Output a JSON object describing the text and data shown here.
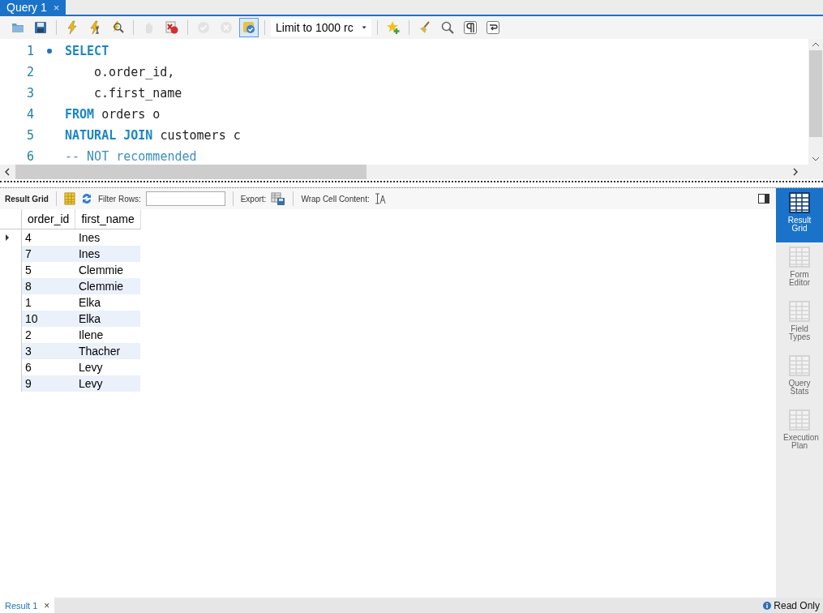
{
  "tab": {
    "title": "Query 1",
    "close": "×"
  },
  "toolbar": [
    {
      "kind": "open",
      "disabled": false,
      "pressed": false
    },
    {
      "kind": "save",
      "disabled": false,
      "pressed": false
    },
    {
      "kind": "execute",
      "disabled": false,
      "pressed": false
    },
    {
      "kind": "execute-current",
      "disabled": false,
      "pressed": false
    },
    {
      "kind": "explain",
      "disabled": false,
      "pressed": false
    },
    {
      "kind": "stop",
      "disabled": true,
      "pressed": false
    },
    {
      "kind": "stop-on-error",
      "disabled": false,
      "pressed": false
    },
    {
      "kind": "commit",
      "disabled": true,
      "pressed": false
    },
    {
      "kind": "rollback",
      "disabled": true,
      "pressed": false
    },
    {
      "kind": "autocommit",
      "disabled": false,
      "pressed": true
    },
    {
      "kind": "limit",
      "label": "Limit to 1000 rc"
    },
    {
      "kind": "snippet",
      "disabled": false,
      "pressed": false
    },
    {
      "kind": "beautify",
      "disabled": false,
      "pressed": false
    },
    {
      "kind": "find",
      "disabled": false,
      "pressed": false
    },
    {
      "kind": "invisibles",
      "disabled": false,
      "pressed": false
    },
    {
      "kind": "wrap",
      "disabled": false,
      "pressed": false
    }
  ],
  "editor": {
    "lines": [
      {
        "number": "1",
        "marker": true,
        "indent": false,
        "tokens": [
          {
            "kind": "keyword",
            "text": "SELECT"
          }
        ]
      },
      {
        "number": "2",
        "marker": false,
        "indent": true,
        "tokens": [
          {
            "kind": "plain",
            "text": "o.order_id,"
          }
        ]
      },
      {
        "number": "3",
        "marker": false,
        "indent": true,
        "tokens": [
          {
            "kind": "plain",
            "text": "c.first_name"
          }
        ]
      },
      {
        "number": "4",
        "marker": false,
        "indent": false,
        "tokens": [
          {
            "kind": "keyword",
            "text": "FROM"
          },
          {
            "kind": "plain",
            "text": " orders o"
          }
        ]
      },
      {
        "number": "5",
        "marker": false,
        "indent": false,
        "tokens": [
          {
            "kind": "keyword",
            "text": "NATURAL JOIN"
          },
          {
            "kind": "plain",
            "text": " customers c"
          }
        ]
      },
      {
        "number": "6",
        "marker": false,
        "indent": false,
        "tokens": [
          {
            "kind": "comment",
            "text": "-- NOT recommended"
          }
        ]
      }
    ]
  },
  "result_toolbar": {
    "label": "Result Grid",
    "filter_label": "Filter Rows:",
    "export_label": "Export:",
    "wrap_label": "Wrap Cell Content:"
  },
  "table": {
    "columns": [
      "order_id",
      "first_name"
    ],
    "rows": [
      {
        "order_id": "4",
        "first_name": "Ines",
        "selected": true
      },
      {
        "order_id": "7",
        "first_name": "Ines",
        "selected": false
      },
      {
        "order_id": "5",
        "first_name": "Clemmie",
        "selected": false
      },
      {
        "order_id": "8",
        "first_name": "Clemmie",
        "selected": false
      },
      {
        "order_id": "1",
        "first_name": "Elka",
        "selected": false
      },
      {
        "order_id": "10",
        "first_name": "Elka",
        "selected": false
      },
      {
        "order_id": "2",
        "first_name": "Ilene",
        "selected": false
      },
      {
        "order_id": "3",
        "first_name": "Thacher",
        "selected": false
      },
      {
        "order_id": "6",
        "first_name": "Levy",
        "selected": false
      },
      {
        "order_id": "9",
        "first_name": "Levy",
        "selected": false
      }
    ]
  },
  "side_panel": [
    {
      "label": "Result Grid",
      "selected": true
    },
    {
      "label": "Form Editor",
      "selected": false
    },
    {
      "label": "Field Types",
      "selected": false
    },
    {
      "label": "Query Stats",
      "selected": false
    },
    {
      "label": "Execution Plan",
      "selected": false
    }
  ],
  "bottom": {
    "tab": "Result 1",
    "close": "×",
    "status": "Read Only"
  }
}
